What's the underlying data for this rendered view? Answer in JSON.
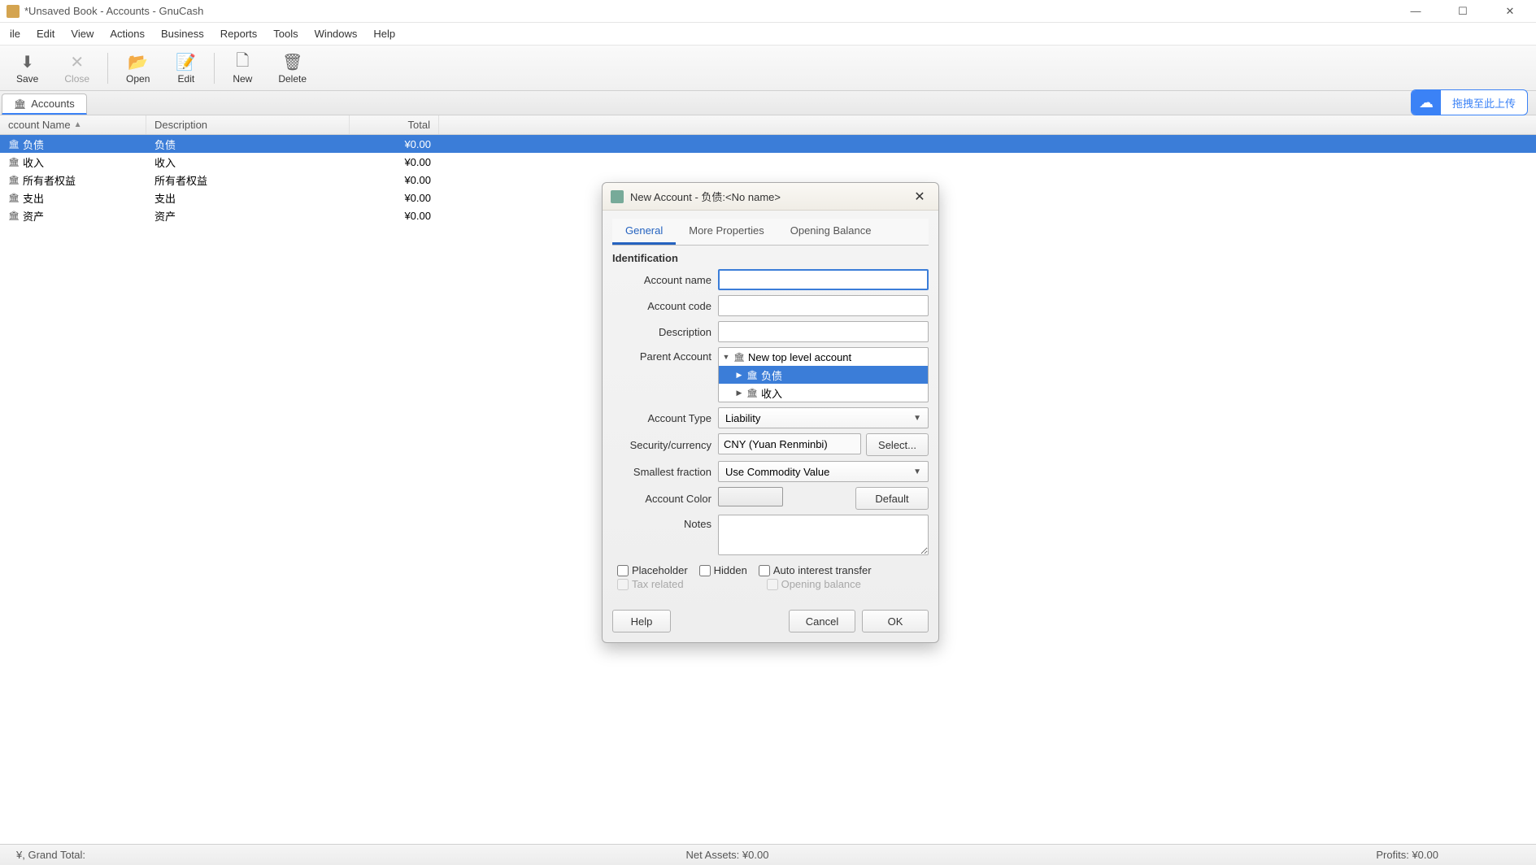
{
  "titlebar": {
    "text": "*Unsaved Book - Accounts - GnuCash"
  },
  "menu": {
    "items": [
      "ile",
      "Edit",
      "View",
      "Actions",
      "Business",
      "Reports",
      "Tools",
      "Windows",
      "Help"
    ]
  },
  "toolbar": {
    "save": "Save",
    "close": "Close",
    "open": "Open",
    "edit": "Edit",
    "new": "New",
    "delete": "Delete"
  },
  "tab": {
    "label": "Accounts"
  },
  "upload": {
    "text": "拖拽至此上传"
  },
  "columns": {
    "name": "ccount Name",
    "desc": "Description",
    "total": "Total"
  },
  "accounts": [
    {
      "name": "负债",
      "desc": "负债",
      "total": "¥0.00",
      "selected": true
    },
    {
      "name": "收入",
      "desc": "收入",
      "total": "¥0.00",
      "selected": false
    },
    {
      "name": "所有者权益",
      "desc": "所有者权益",
      "total": "¥0.00",
      "selected": false
    },
    {
      "name": "支出",
      "desc": "支出",
      "total": "¥0.00",
      "selected": false
    },
    {
      "name": "资产",
      "desc": "资产",
      "total": "¥0.00",
      "selected": false
    }
  ],
  "status": {
    "left": "¥, Grand Total:",
    "center": "Net Assets:  ¥0.00",
    "right": "Profits:  ¥0.00"
  },
  "dialog": {
    "title": "New Account - 负债:<No name>",
    "tabs": {
      "general": "General",
      "more": "More Properties",
      "opening": "Opening Balance"
    },
    "section": "Identification",
    "labels": {
      "name": "Account name",
      "code": "Account code",
      "desc": "Description",
      "parent": "Parent Account",
      "type": "Account Type",
      "currency": "Security/currency",
      "fraction": "Smallest fraction",
      "color": "Account Color",
      "notes": "Notes"
    },
    "parent_tree": {
      "root": "New top level account",
      "children": [
        "负债",
        "收入"
      ]
    },
    "type_value": "Liability",
    "currency_value": "CNY (Yuan Renminbi)",
    "select_btn": "Select...",
    "fraction_value": "Use Commodity Value",
    "default_btn": "Default",
    "checks": {
      "placeholder": "Placeholder",
      "hidden": "Hidden",
      "autointerest": "Auto interest transfer",
      "tax": "Tax related",
      "openbal": "Opening balance"
    },
    "buttons": {
      "help": "Help",
      "cancel": "Cancel",
      "ok": "OK"
    }
  }
}
